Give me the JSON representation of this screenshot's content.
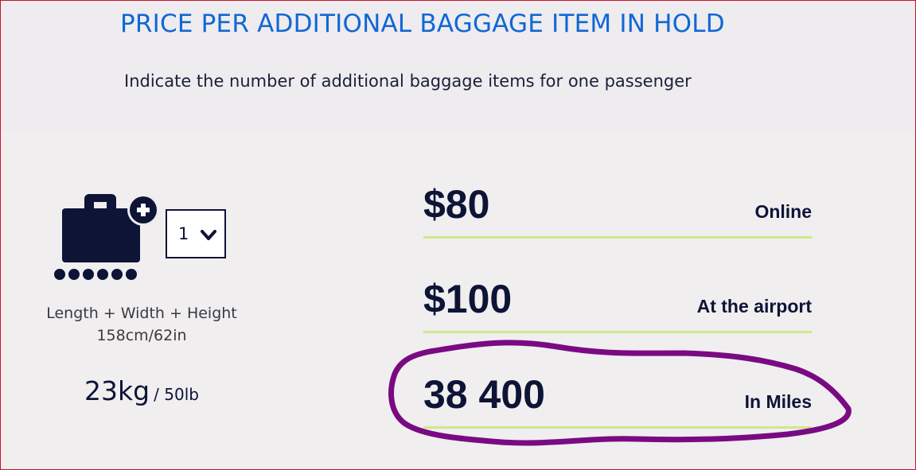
{
  "header": {
    "title": "PRICE PER ADDITIONAL BAGGAGE ITEM IN HOLD",
    "subtitle": "Indicate the number of additional baggage items for one passenger"
  },
  "baggage": {
    "icon": "suitcase-add-icon",
    "quantity_selected": "1",
    "dimensions_label": "Length + Width + Height",
    "dimensions_value": "158cm/62in",
    "weight_kg": "23kg",
    "weight_lb": "/ 50lb"
  },
  "prices": [
    {
      "amount": "$80",
      "label": "Online"
    },
    {
      "amount": "$100",
      "label": "At the airport"
    },
    {
      "amount": "38 400",
      "label": "In Miles"
    }
  ],
  "colors": {
    "title": "#1067d6",
    "navy": "#0d1436",
    "divider": "#cfe88a",
    "annotation": "#7a0a82",
    "border": "#c8102e"
  }
}
